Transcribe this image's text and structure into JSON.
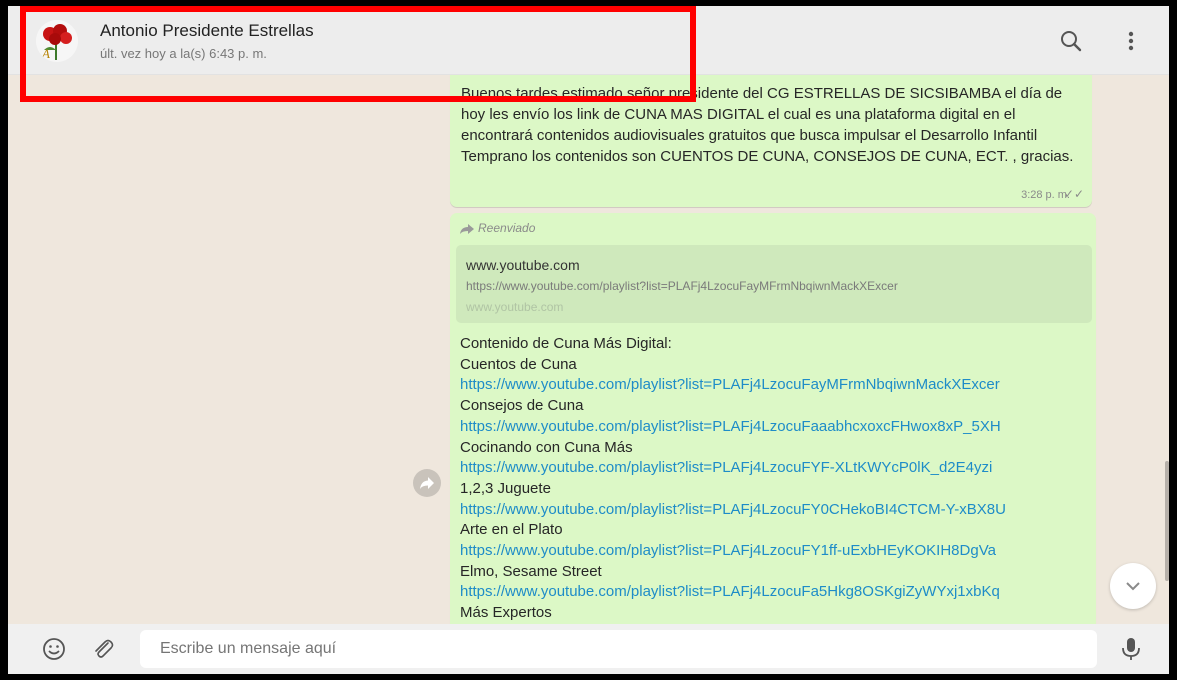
{
  "header": {
    "contact_name": "Antonio Presidente Estrellas",
    "last_seen": "últ. vez hoy a la(s) 6:43 p. m.",
    "icons": [
      "search-icon",
      "menu-icon"
    ]
  },
  "message1": {
    "text": "Buenos tardes estimado señor presidente del CG ESTRELLAS DE SICSIBAMBA el día de hoy les envío los link de CUNA MAS DIGITAL el cual es una plataforma digital en el encontrará contenidos audiovisuales gratuitos que busca impulsar el Desarrollo Infantil Temprano los contenidos son CUENTOS DE CUNA, CONSEJOS DE CUNA, ECT. , gracias.",
    "time": "3:28 p. m.",
    "status_icon": "double-check-icon"
  },
  "message2": {
    "forwarded_label": "Reenviado",
    "preview": {
      "title": "www.youtube.com",
      "url": "https://www.youtube.com/playlist?list=PLAFj4LzocuFayMFrmNbqiwnMackXExcer",
      "domain": "www.youtube.com"
    },
    "lines": [
      {
        "text": "Contenido de Cuna Más Digital:",
        "type": "text"
      },
      {
        "text": "Cuentos de Cuna",
        "type": "text"
      },
      {
        "text": "https://www.youtube.com/playlist?list=PLAFj4LzocuFayMFrmNbqiwnMackXExcer",
        "type": "link"
      },
      {
        "text": "Consejos de Cuna",
        "type": "text"
      },
      {
        "text": "https://www.youtube.com/playlist?list=PLAFj4LzocuFaaabhcxoxcFHwox8xP_5XH",
        "type": "link"
      },
      {
        "text": "Cocinando con Cuna Más",
        "type": "text"
      },
      {
        "text": "https://www.youtube.com/playlist?list=PLAFj4LzocuFYF-XLtKWYcP0lK_d2E4yzi",
        "type": "link"
      },
      {
        "text": "1,2,3 Juguete",
        "type": "text"
      },
      {
        "text": "https://www.youtube.com/playlist?list=PLAFj4LzocuFY0CHekoBI4CTCM-Y-xBX8U",
        "type": "link"
      },
      {
        "text": "Arte en el Plato",
        "type": "text"
      },
      {
        "text": "https://www.youtube.com/playlist?list=PLAFj4LzocuFY1ff-uExbHEyKOKIH8DgVa",
        "type": "link"
      },
      {
        "text": "Elmo, Sesame Street",
        "type": "text"
      },
      {
        "text": "https://www.youtube.com/playlist?list=PLAFj4LzocuFa5Hkg8OSKgiZyWYxj1xbKq",
        "type": "link"
      },
      {
        "text": "Más Expertos",
        "type": "text"
      }
    ]
  },
  "footer": {
    "placeholder": "Escribe un mensaje aquí",
    "icons": [
      "emoji-icon",
      "attach-icon",
      "mic-icon"
    ]
  },
  "colors": {
    "highlight": "#ff0000",
    "bubble": "#dcf8c6",
    "link": "#1e8cc8",
    "background": "#efe7dd"
  }
}
